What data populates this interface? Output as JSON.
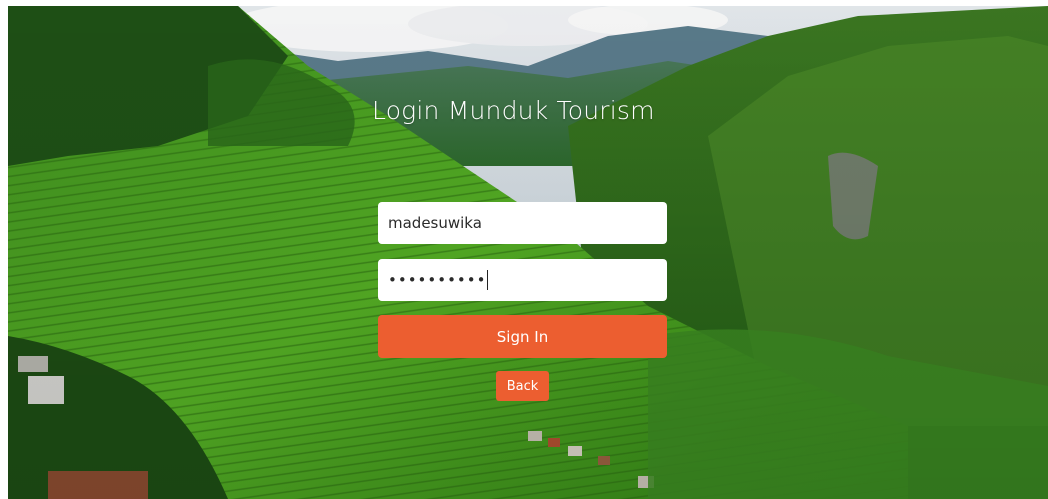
{
  "login": {
    "title": "Login Munduk Tourism",
    "username_value": "madesuwika",
    "password_mask": "••••••••••",
    "signin_label": "Sign In",
    "back_label": "Back"
  },
  "colors": {
    "accent": "#ec5e30",
    "field_bg": "#ffffff",
    "title_text": "#ffffff"
  }
}
